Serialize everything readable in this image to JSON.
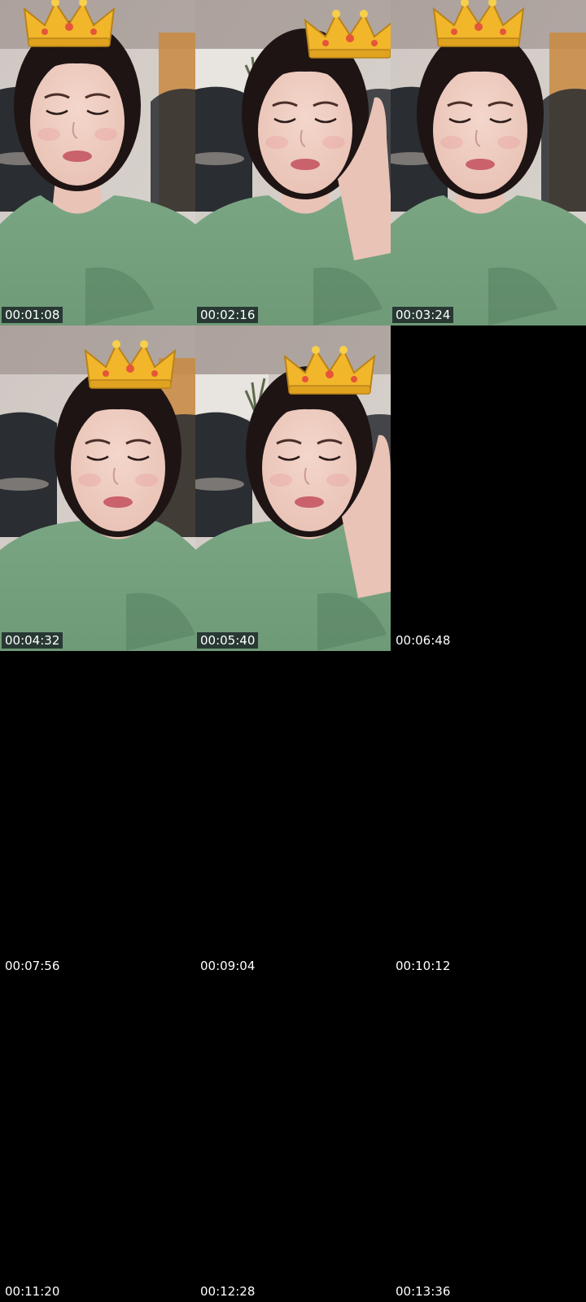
{
  "sheet": {
    "frames": [
      {
        "timestamp": "00:01:08",
        "has_image": true,
        "scene": "selfie-crown-filter"
      },
      {
        "timestamp": "00:02:16",
        "has_image": true,
        "scene": "selfie-crown-filter-hand-on-cheek"
      },
      {
        "timestamp": "00:03:24",
        "has_image": true,
        "scene": "selfie-crown-filter"
      },
      {
        "timestamp": "00:04:32",
        "has_image": true,
        "scene": "selfie-crown-filter"
      },
      {
        "timestamp": "00:05:40",
        "has_image": true,
        "scene": "selfie-crown-filter-hand-on-cheek"
      },
      {
        "timestamp": "00:06:48",
        "has_image": false
      },
      {
        "timestamp": "00:07:56",
        "has_image": false
      },
      {
        "timestamp": "00:09:04",
        "has_image": false
      },
      {
        "timestamp": "00:10:12",
        "has_image": false
      },
      {
        "timestamp": "00:11:20",
        "has_image": false
      },
      {
        "timestamp": "00:12:28",
        "has_image": false
      },
      {
        "timestamp": "00:13:36",
        "has_image": false
      }
    ]
  },
  "colors": {
    "background": "#000000",
    "shirt": "#6f9a78",
    "skin": "#e9c3b6",
    "hair": "#1e1414",
    "crown": "#f2b62b",
    "wall": "#d9d4cf",
    "chair": "#2a2d31"
  }
}
